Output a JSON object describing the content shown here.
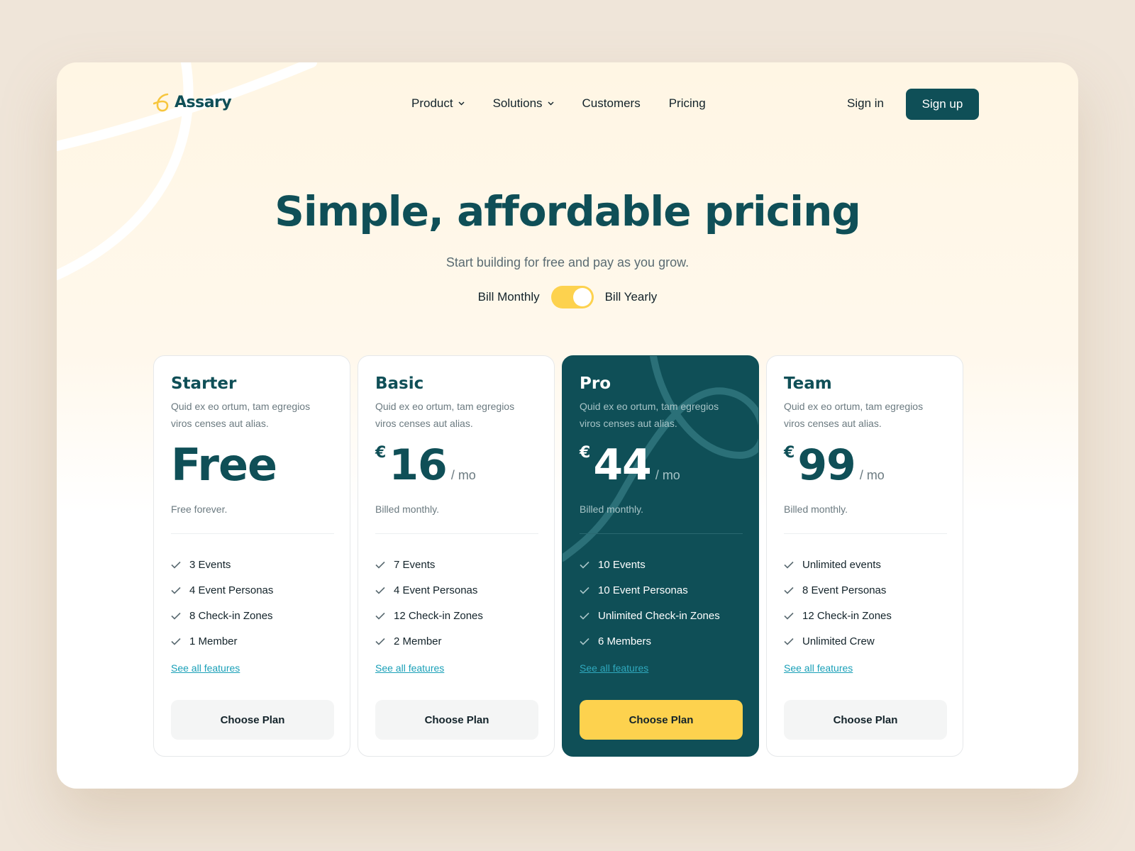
{
  "brand": {
    "name": "Assary"
  },
  "nav": {
    "items": [
      {
        "label": "Product",
        "dropdown": true
      },
      {
        "label": "Solutions",
        "dropdown": true
      },
      {
        "label": "Customers",
        "dropdown": false
      },
      {
        "label": "Pricing",
        "dropdown": false
      }
    ],
    "signin": "Sign in",
    "signup": "Sign up"
  },
  "hero": {
    "title": "Simple, affordable pricing",
    "subtitle": "Start building for free and pay as you grow.",
    "billing": {
      "monthly": "Bill Monthly",
      "yearly": "Bill Yearly",
      "yearly_selected": true
    }
  },
  "plans": [
    {
      "name": "Starter",
      "desc": "Quid ex eo ortum, tam egregios viros censes aut alias.",
      "currency": "",
      "price": "Free",
      "per": "",
      "note": "Free forever.",
      "features": [
        "3 Events",
        "4 Event Personas",
        "8 Check-in Zones",
        "1 Member"
      ],
      "see_all": "See all features",
      "cta": "Choose Plan"
    },
    {
      "name": "Basic",
      "desc": "Quid ex eo ortum, tam egregios viros censes aut alias.",
      "currency": "€",
      "price": "16",
      "per": "/ mo",
      "note": "Billed monthly.",
      "features": [
        "7 Events",
        "4 Event Personas",
        "12 Check-in Zones",
        "2 Member"
      ],
      "see_all": "See all features",
      "cta": "Choose Plan"
    },
    {
      "name": "Pro",
      "desc": "Quid ex eo ortum, tam egregios viros censes aut alias.",
      "currency": "€",
      "price": "44",
      "per": "/ mo",
      "note": "Billed monthly.",
      "features": [
        "10 Events",
        "10 Event Personas",
        "Unlimited Check-in Zones",
        "6 Members"
      ],
      "see_all": "See all features",
      "cta": "Choose Plan"
    },
    {
      "name": "Team",
      "desc": "Quid ex eo ortum, tam egregios viros censes aut alias.",
      "currency": "€",
      "price": "99",
      "per": "/ mo",
      "note": "Billed monthly.",
      "features": [
        "Unlimited events",
        "8 Event Personas",
        "12 Check-in Zones",
        "Unlimited Crew"
      ],
      "see_all": "See all features",
      "cta": "Choose Plan"
    }
  ],
  "colors": {
    "primary": "#0f4f57",
    "accent": "#fdd24e",
    "link": "#1aa0b8",
    "page_bg": "#efe5d9"
  },
  "icons": {
    "logo": "assary-logo-icon",
    "dropdown": "chevron-down-icon",
    "feature": "check-icon"
  }
}
